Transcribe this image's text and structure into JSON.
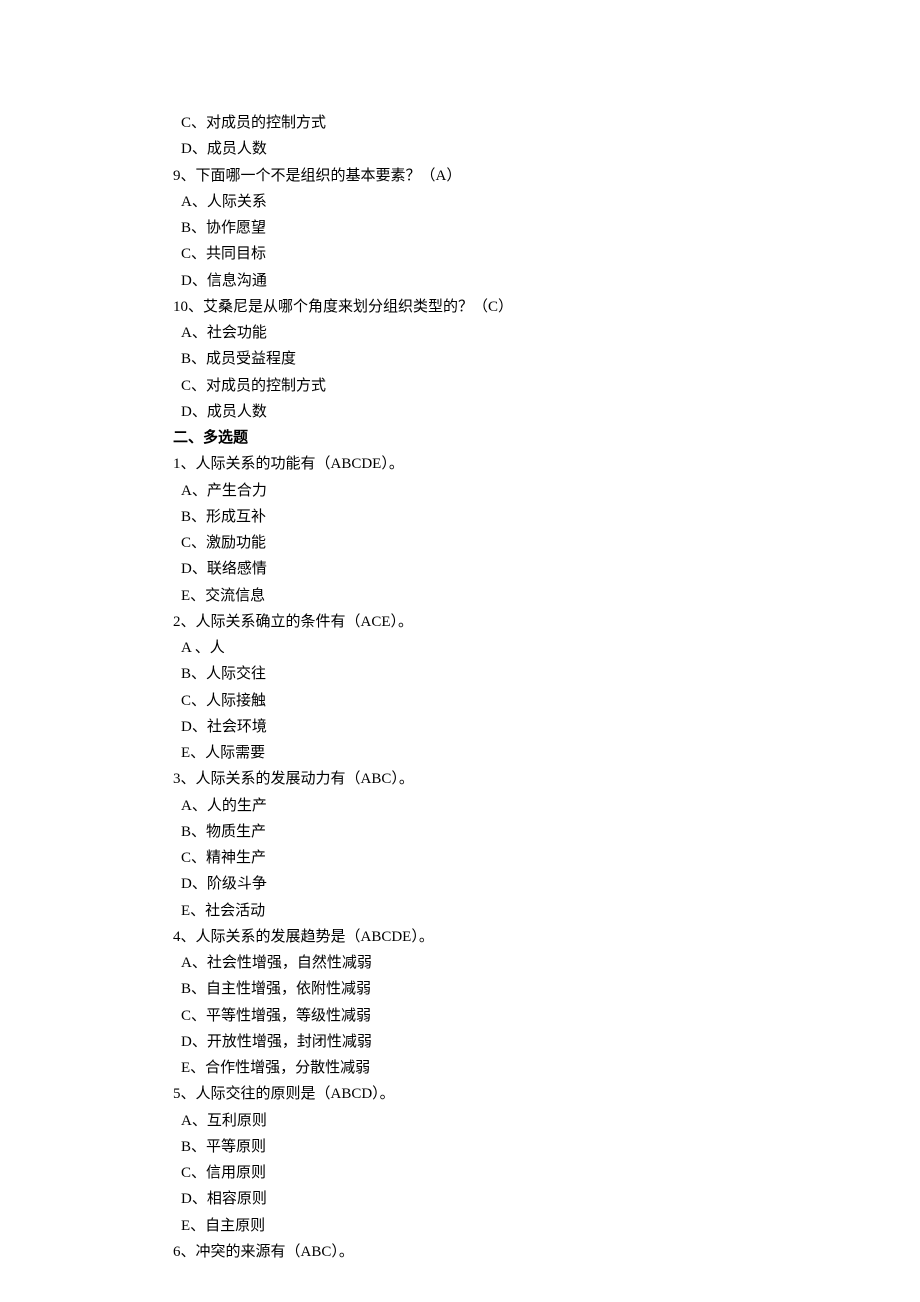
{
  "lines": [
    {
      "indent": "option",
      "bold": false,
      "text": "C、对成员的控制方式"
    },
    {
      "indent": "option",
      "bold": false,
      "text": "D、成员人数"
    },
    {
      "indent": "",
      "bold": false,
      "text": "9、下面哪一个不是组织的基本要素？（A）"
    },
    {
      "indent": "option",
      "bold": false,
      "text": "A、人际关系"
    },
    {
      "indent": "option",
      "bold": false,
      "text": "B、协作愿望"
    },
    {
      "indent": "option",
      "bold": false,
      "text": "C、共同目标"
    },
    {
      "indent": "option",
      "bold": false,
      "text": "D、信息沟通"
    },
    {
      "indent": "",
      "bold": false,
      "text": "10、艾桑尼是从哪个角度来划分组织类型的？（C）"
    },
    {
      "indent": "option",
      "bold": false,
      "text": "A、社会功能"
    },
    {
      "indent": "option",
      "bold": false,
      "text": "B、成员受益程度"
    },
    {
      "indent": "option",
      "bold": false,
      "text": "C、对成员的控制方式"
    },
    {
      "indent": "option",
      "bold": false,
      "text": "D、成员人数"
    },
    {
      "indent": "",
      "bold": true,
      "text": "二、多选题"
    },
    {
      "indent": "",
      "bold": false,
      "text": "1、人际关系的功能有（ABCDE）。"
    },
    {
      "indent": "option",
      "bold": false,
      "text": "A、产生合力"
    },
    {
      "indent": "option",
      "bold": false,
      "text": "B、形成互补"
    },
    {
      "indent": "option",
      "bold": false,
      "text": "C、激励功能"
    },
    {
      "indent": "option",
      "bold": false,
      "text": "D、联络感情"
    },
    {
      "indent": "option",
      "bold": false,
      "text": "E、交流信息"
    },
    {
      "indent": "",
      "bold": false,
      "text": "2、人际关系确立的条件有（ACE）。"
    },
    {
      "indent": "option",
      "bold": false,
      "text": "A 、人"
    },
    {
      "indent": "option",
      "bold": false,
      "text": "B、人际交往"
    },
    {
      "indent": "option",
      "bold": false,
      "text": "C、人际接触"
    },
    {
      "indent": "option",
      "bold": false,
      "text": "D、社会环境"
    },
    {
      "indent": "option",
      "bold": false,
      "text": "E、人际需要"
    },
    {
      "indent": "",
      "bold": false,
      "text": "3、人际关系的发展动力有（ABC）。"
    },
    {
      "indent": "option",
      "bold": false,
      "text": "A、人的生产"
    },
    {
      "indent": "option",
      "bold": false,
      "text": "B、物质生产"
    },
    {
      "indent": "option",
      "bold": false,
      "text": "C、精神生产"
    },
    {
      "indent": "option",
      "bold": false,
      "text": "D、阶级斗争"
    },
    {
      "indent": "option",
      "bold": false,
      "text": "E、社会活动"
    },
    {
      "indent": "",
      "bold": false,
      "text": "4、人际关系的发展趋势是（ABCDE）。"
    },
    {
      "indent": "option",
      "bold": false,
      "text": "A、社会性增强，自然性减弱"
    },
    {
      "indent": "option",
      "bold": false,
      "text": "B、自主性增强，依附性减弱"
    },
    {
      "indent": "option",
      "bold": false,
      "text": "C、平等性增强，等级性减弱"
    },
    {
      "indent": "option",
      "bold": false,
      "text": "D、开放性增强，封闭性减弱"
    },
    {
      "indent": "option",
      "bold": false,
      "text": "E、合作性增强，分散性减弱"
    },
    {
      "indent": "",
      "bold": false,
      "text": "5、人际交往的原则是（ABCD）。"
    },
    {
      "indent": "option",
      "bold": false,
      "text": "A、互利原则"
    },
    {
      "indent": "option",
      "bold": false,
      "text": "B、平等原则"
    },
    {
      "indent": "option",
      "bold": false,
      "text": "C、信用原则"
    },
    {
      "indent": "option",
      "bold": false,
      "text": "D、相容原则"
    },
    {
      "indent": "option",
      "bold": false,
      "text": "E、自主原则"
    },
    {
      "indent": "",
      "bold": false,
      "text": "6、冲突的来源有（ABC）。"
    }
  ]
}
